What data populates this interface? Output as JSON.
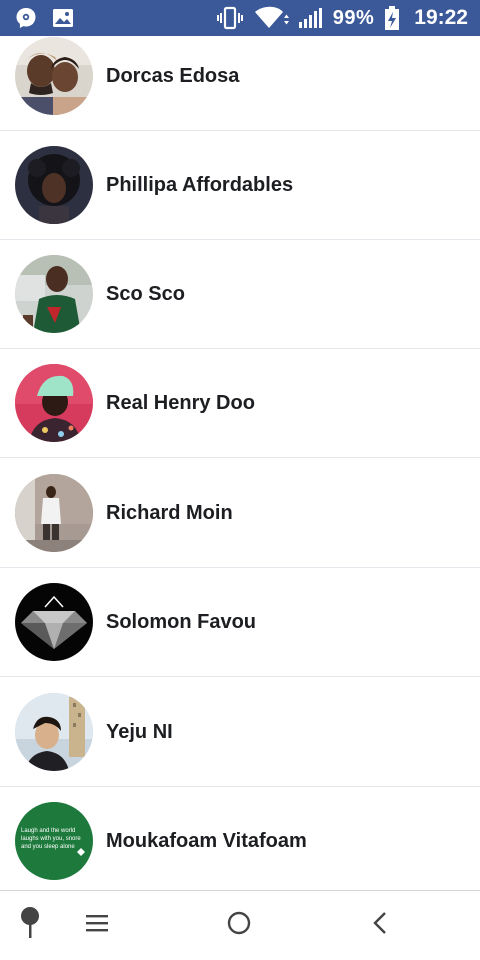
{
  "status_bar": {
    "battery": "99%",
    "time": "19:22",
    "icons": [
      "messenger-notification-icon",
      "gallery-notification-icon",
      "vibrate-icon",
      "wifi-icon",
      "signal-icon",
      "battery-charging-icon"
    ]
  },
  "contacts": [
    {
      "name": "Dorcas Edosa"
    },
    {
      "name": "Phillipa Affordables"
    },
    {
      "name": "Sco Sco"
    },
    {
      "name": "Real Henry Doo"
    },
    {
      "name": "Richard Moin"
    },
    {
      "name": "Solomon Favou"
    },
    {
      "name": "Yeju NI"
    },
    {
      "name": "Moukafoam Vitafoam",
      "avatar_text": "Laugh and the world laughs with you, snore and you sleep alone"
    }
  ],
  "nav_bar": {
    "icons": [
      "pin-icon",
      "menu-icon",
      "home-icon",
      "back-icon"
    ]
  },
  "colors": {
    "status_bar_bg": "#3b5998",
    "name_text": "#1c1e21",
    "divider": "#e4e6eb"
  }
}
